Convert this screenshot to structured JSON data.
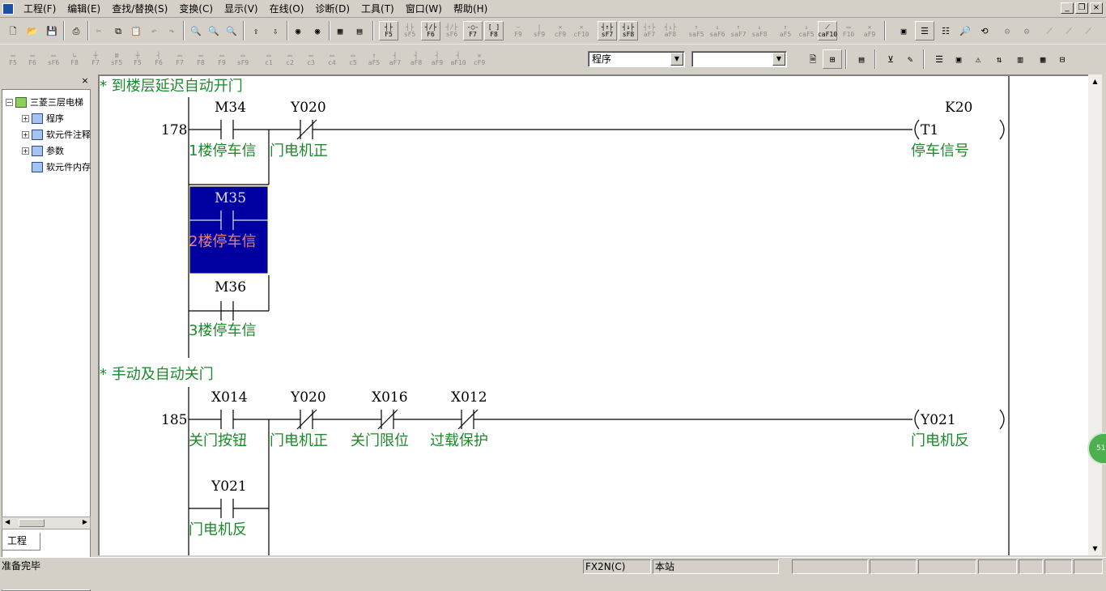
{
  "menubar": {
    "items": [
      {
        "label": "工程(F)"
      },
      {
        "label": "编辑(E)"
      },
      {
        "label": "查找/替换(S)"
      },
      {
        "label": "变换(C)"
      },
      {
        "label": "显示(V)"
      },
      {
        "label": "在线(O)"
      },
      {
        "label": "诊断(D)"
      },
      {
        "label": "工具(T)"
      },
      {
        "label": "窗口(W)"
      },
      {
        "label": "帮助(H)"
      }
    ],
    "window_controls": [
      "_",
      "❐",
      "×"
    ]
  },
  "toolbar1": {
    "ladder_keys": [
      "F5",
      "sF5",
      "F6",
      "sF6",
      "F7",
      "F8",
      "F9",
      "sF9",
      "cF9",
      "cF10",
      "sF7",
      "sF8",
      "aF7",
      "aF8",
      "saF5",
      "saF6",
      "saF7",
      "saF8",
      "aF5",
      "caF5",
      "caF10",
      "F10",
      "aF9"
    ]
  },
  "toolbar2": {
    "keys": [
      "F5",
      "F6",
      "sF6",
      "F8",
      "F7",
      "sF5",
      "F5",
      "F6",
      "F7",
      "F8",
      "F9",
      "sF9",
      "c1",
      "c2",
      "c3",
      "c4",
      "c5",
      "aF5",
      "aF7",
      "aF8",
      "aF9",
      "aF10",
      "cF9"
    ],
    "program_select": "程序",
    "second_select": ""
  },
  "project": {
    "close": "×",
    "root": "三菱三层电梯",
    "items": [
      "程序",
      "软元件注释",
      "参数",
      "软元件内存"
    ],
    "tab": "工程"
  },
  "ladder": {
    "rungs": [
      {
        "comment": "* 到楼层延迟自动开门",
        "step": "178",
        "contacts": [
          {
            "device": "M34",
            "note": "1楼停车信",
            "type": "NO"
          },
          {
            "device": "Y020",
            "note": "门电机正",
            "type": "NC"
          }
        ],
        "branches": [
          {
            "device": "M35",
            "note": "2楼停车信",
            "type": "NO",
            "selected": true
          },
          {
            "device": "M36",
            "note": "3楼停车信",
            "type": "NO",
            "selected": false
          }
        ],
        "coil": {
          "device": "T1",
          "param": "K20",
          "note": "停车信号"
        }
      },
      {
        "comment": "* 手动及自动关门",
        "step": "185",
        "contacts": [
          {
            "device": "X014",
            "note": "关门按钮",
            "type": "NO"
          },
          {
            "device": "Y020",
            "note": "门电机正",
            "type": "NC"
          },
          {
            "device": "X016",
            "note": "关门限位",
            "type": "NC"
          },
          {
            "device": "X012",
            "note": "过载保护",
            "type": "NC"
          }
        ],
        "branches": [
          {
            "device": "Y021",
            "note": "门电机反",
            "type": "NO",
            "selected": false
          }
        ],
        "coil": {
          "device": "Y021",
          "param": "",
          "note": "门电机反"
        }
      }
    ]
  },
  "badge": {
    "text": "51"
  },
  "statusbar": {
    "message": "准备完毕",
    "plc_type": "FX2N(C)",
    "station": "本站"
  },
  "colors": {
    "comment_green": "#1a8a2a",
    "selection_blue": "#0000a0",
    "selection_note": "#e88080"
  }
}
